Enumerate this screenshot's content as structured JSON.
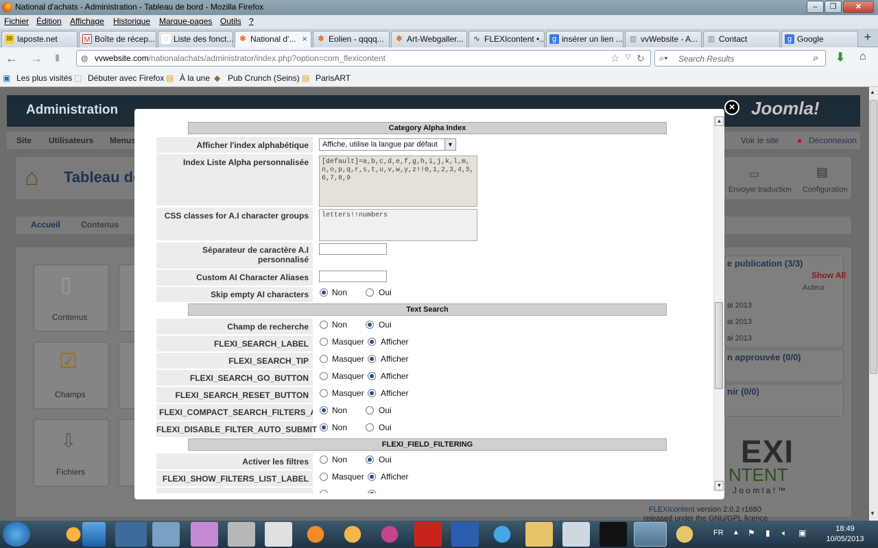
{
  "window": {
    "title": "National d'achats - Administration - Tableau de bord - Mozilla Firefox"
  },
  "menubar": [
    "Fichier",
    "Édition",
    "Affichage",
    "Historique",
    "Marque-pages",
    "Outils",
    "?"
  ],
  "tabs": [
    {
      "label": "laposte.net",
      "icon": "laposte-icon"
    },
    {
      "label": "Boîte de récep...",
      "icon": "gmail-icon"
    },
    {
      "label": "Liste des fonct...",
      "icon": "page-icon"
    },
    {
      "label": "National d'...",
      "icon": "joomla-icon",
      "active": true
    },
    {
      "label": "Eolien - qqqq...",
      "icon": "joomla-icon"
    },
    {
      "label": "Art-Webgaller...",
      "icon": "joomla-icon"
    },
    {
      "label": "FLEXIcontent •...",
      "icon": "flexi-icon"
    },
    {
      "label": "insérer un lien ...",
      "icon": "google-icon"
    },
    {
      "label": "vvWebsite - A...",
      "icon": "page-icon"
    },
    {
      "label": "Contact",
      "icon": "page-icon"
    },
    {
      "label": "Google",
      "icon": "google-icon"
    }
  ],
  "nav": {
    "url_domain": "vvwebsite.com",
    "url_path": "/nationalachats/administrator/index.php?option=com_flexicontent",
    "search_placeholder": "Search Results"
  },
  "bookmarks": [
    "Les plus visités",
    "Débuter avec Firefox",
    "À la une",
    "Pub Crunch (Seins)",
    "ParisART"
  ],
  "joomla": {
    "header": "Administration",
    "logo": "Joomla!",
    "menu": [
      "Site",
      "Utilisateurs",
      "Menus"
    ],
    "page_title": "Tableau de",
    "view_site": "Voir le site",
    "logout": "Déconnexion",
    "toolbar": [
      "Envoyer traduction",
      "Configuration"
    ],
    "tabs": [
      "Accueil",
      "Contenus"
    ],
    "tiles": [
      "Contenus",
      "Champs",
      "Fichiers"
    ],
    "right_panels": {
      "publication": "e publication (3/3)",
      "show_all": "Show All",
      "author_col": "Auteur",
      "rows": [
        "ai 2013",
        "ai 2013",
        "ai 2013"
      ],
      "approval": "n approuvée (0/0)",
      "define": "nir (0/0)"
    },
    "flexi_logo_line1": "EXI",
    "flexi_logo_line2": "NTENT",
    "flexi_logo_line3": "J o o m l a ! ™",
    "footer_version": "FLEXIcontent",
    "footer_version_rest": "version 2.0.2 r1680",
    "footer_licence": "released under the GNU/GPL licence"
  },
  "form": {
    "sections": {
      "alpha": "Category Alpha Index",
      "text_search": "Text Search",
      "filtering": "FLEXI_FIELD_FILTERING"
    },
    "fields": {
      "show_alpha_index": {
        "label": "Afficher l'index alphabétique",
        "value": "Affiche, utilise la langue par défaut"
      },
      "alpha_list": {
        "label": "Index Liste Alpha personnalisée",
        "value": "[default]=a,b,c,d,e,f,g,h,i,j,k,l,m,n,o,p,q,r,s,t,u,v,w,y,z!!0,1,2,3,4,5,6,7,8,9"
      },
      "css_classes": {
        "label": "CSS classes for A.I character groups",
        "value": "letters!!numbers"
      },
      "separator": {
        "label": "Séparateur de caractère A.I personnalisé",
        "value": ""
      },
      "aliases": {
        "label": "Custom AI Character Aliases",
        "value": ""
      },
      "skip_empty": {
        "label": "Skip empty AI characters",
        "options": [
          "Non",
          "Oui"
        ],
        "selected": "Non"
      },
      "search_field": {
        "label": "Champ de recherche",
        "options": [
          "Non",
          "Oui"
        ],
        "selected": "Oui"
      },
      "search_label": {
        "label": "FLEXI_SEARCH_LABEL",
        "options": [
          "Masquer",
          "Afficher"
        ],
        "selected": "Afficher"
      },
      "search_tip": {
        "label": "FLEXI_SEARCH_TIP",
        "options": [
          "Masquer",
          "Afficher"
        ],
        "selected": "Afficher"
      },
      "search_go": {
        "label": "FLEXI_SEARCH_GO_BUTTON",
        "options": [
          "Masquer",
          "Afficher"
        ],
        "selected": "Afficher"
      },
      "search_reset": {
        "label": "FLEXI_SEARCH_RESET_BUTTON",
        "options": [
          "Masquer",
          "Afficher"
        ],
        "selected": "Afficher"
      },
      "compact_filters": {
        "label": "FLEXI_COMPACT_SEARCH_FILTERS_AREA",
        "options": [
          "Non",
          "Oui"
        ],
        "selected": "Non"
      },
      "disable_auto_submit": {
        "label": "FLEXI_DISABLE_FILTER_AUTO_SUBMIT",
        "options": [
          "Non",
          "Oui"
        ],
        "selected": "Non"
      },
      "enable_filters": {
        "label": "Activer les filtres",
        "options": [
          "Non",
          "Oui"
        ],
        "selected": "Oui"
      },
      "show_filters_label": {
        "label": "FLEXI_SHOW_FILTERS_LIST_LABEL",
        "options": [
          "Masquer",
          "Afficher"
        ],
        "selected": "Afficher"
      }
    }
  },
  "taskbar": {
    "lang": "FR",
    "time": "18:49",
    "date": "10/05/2013"
  }
}
